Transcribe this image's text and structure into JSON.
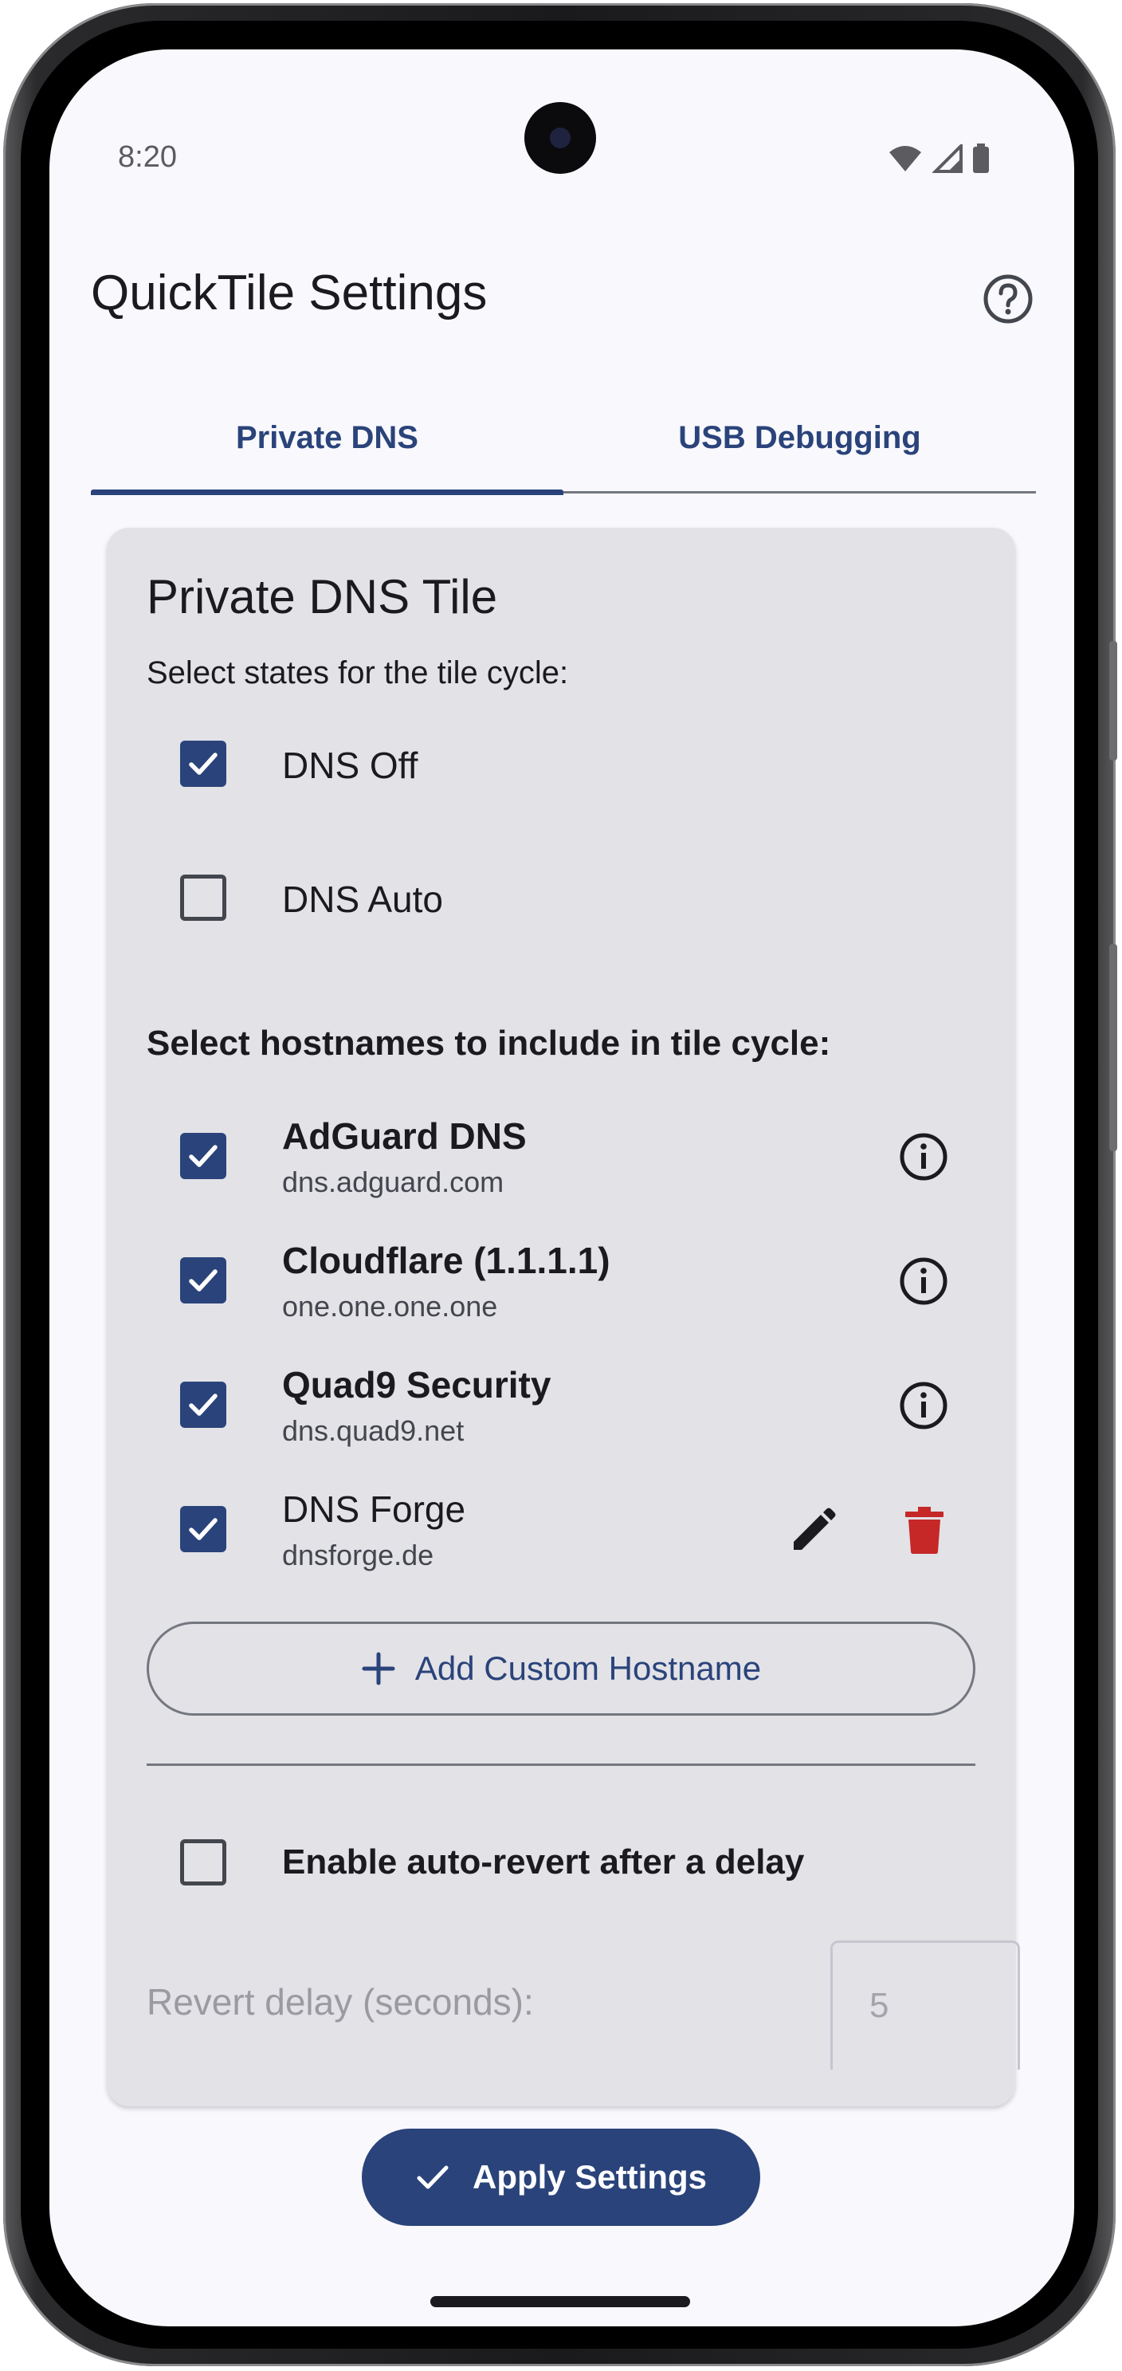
{
  "status_bar": {
    "time": "8:20"
  },
  "header": {
    "title": "QuickTile Settings"
  },
  "tabs": [
    {
      "label": "Private DNS",
      "active": true
    },
    {
      "label": "USB Debugging",
      "active": false
    }
  ],
  "card": {
    "title": "Private DNS Tile",
    "states_subtitle": "Select states for the tile cycle:",
    "states": [
      {
        "label": "DNS Off",
        "checked": true
      },
      {
        "label": "DNS Auto",
        "checked": false
      }
    ],
    "hostnames_heading": "Select hostnames to include in tile cycle:",
    "hostnames": [
      {
        "name": "AdGuard DNS",
        "host": "dns.adguard.com",
        "checked": true
      },
      {
        "name": "Cloudflare (1.1.1.1)",
        "host": "one.one.one.one",
        "checked": true
      },
      {
        "name": "Quad9 Security",
        "host": "dns.quad9.net",
        "checked": true
      },
      {
        "name": "DNS Forge",
        "host": "dnsforge.de",
        "checked": true
      }
    ],
    "add_button_label": "Add Custom Hostname",
    "auto_revert_label": "Enable auto-revert after a delay",
    "auto_revert_checked": false,
    "revert_delay_label": "Revert delay (seconds):",
    "revert_delay_value": "5"
  },
  "apply_button_label": "Apply Settings",
  "colors": {
    "primary": "#2a437a",
    "card_bg": "#e2e2e7",
    "screen_bg": "#f8f8fd",
    "delete_red": "#c62828"
  }
}
